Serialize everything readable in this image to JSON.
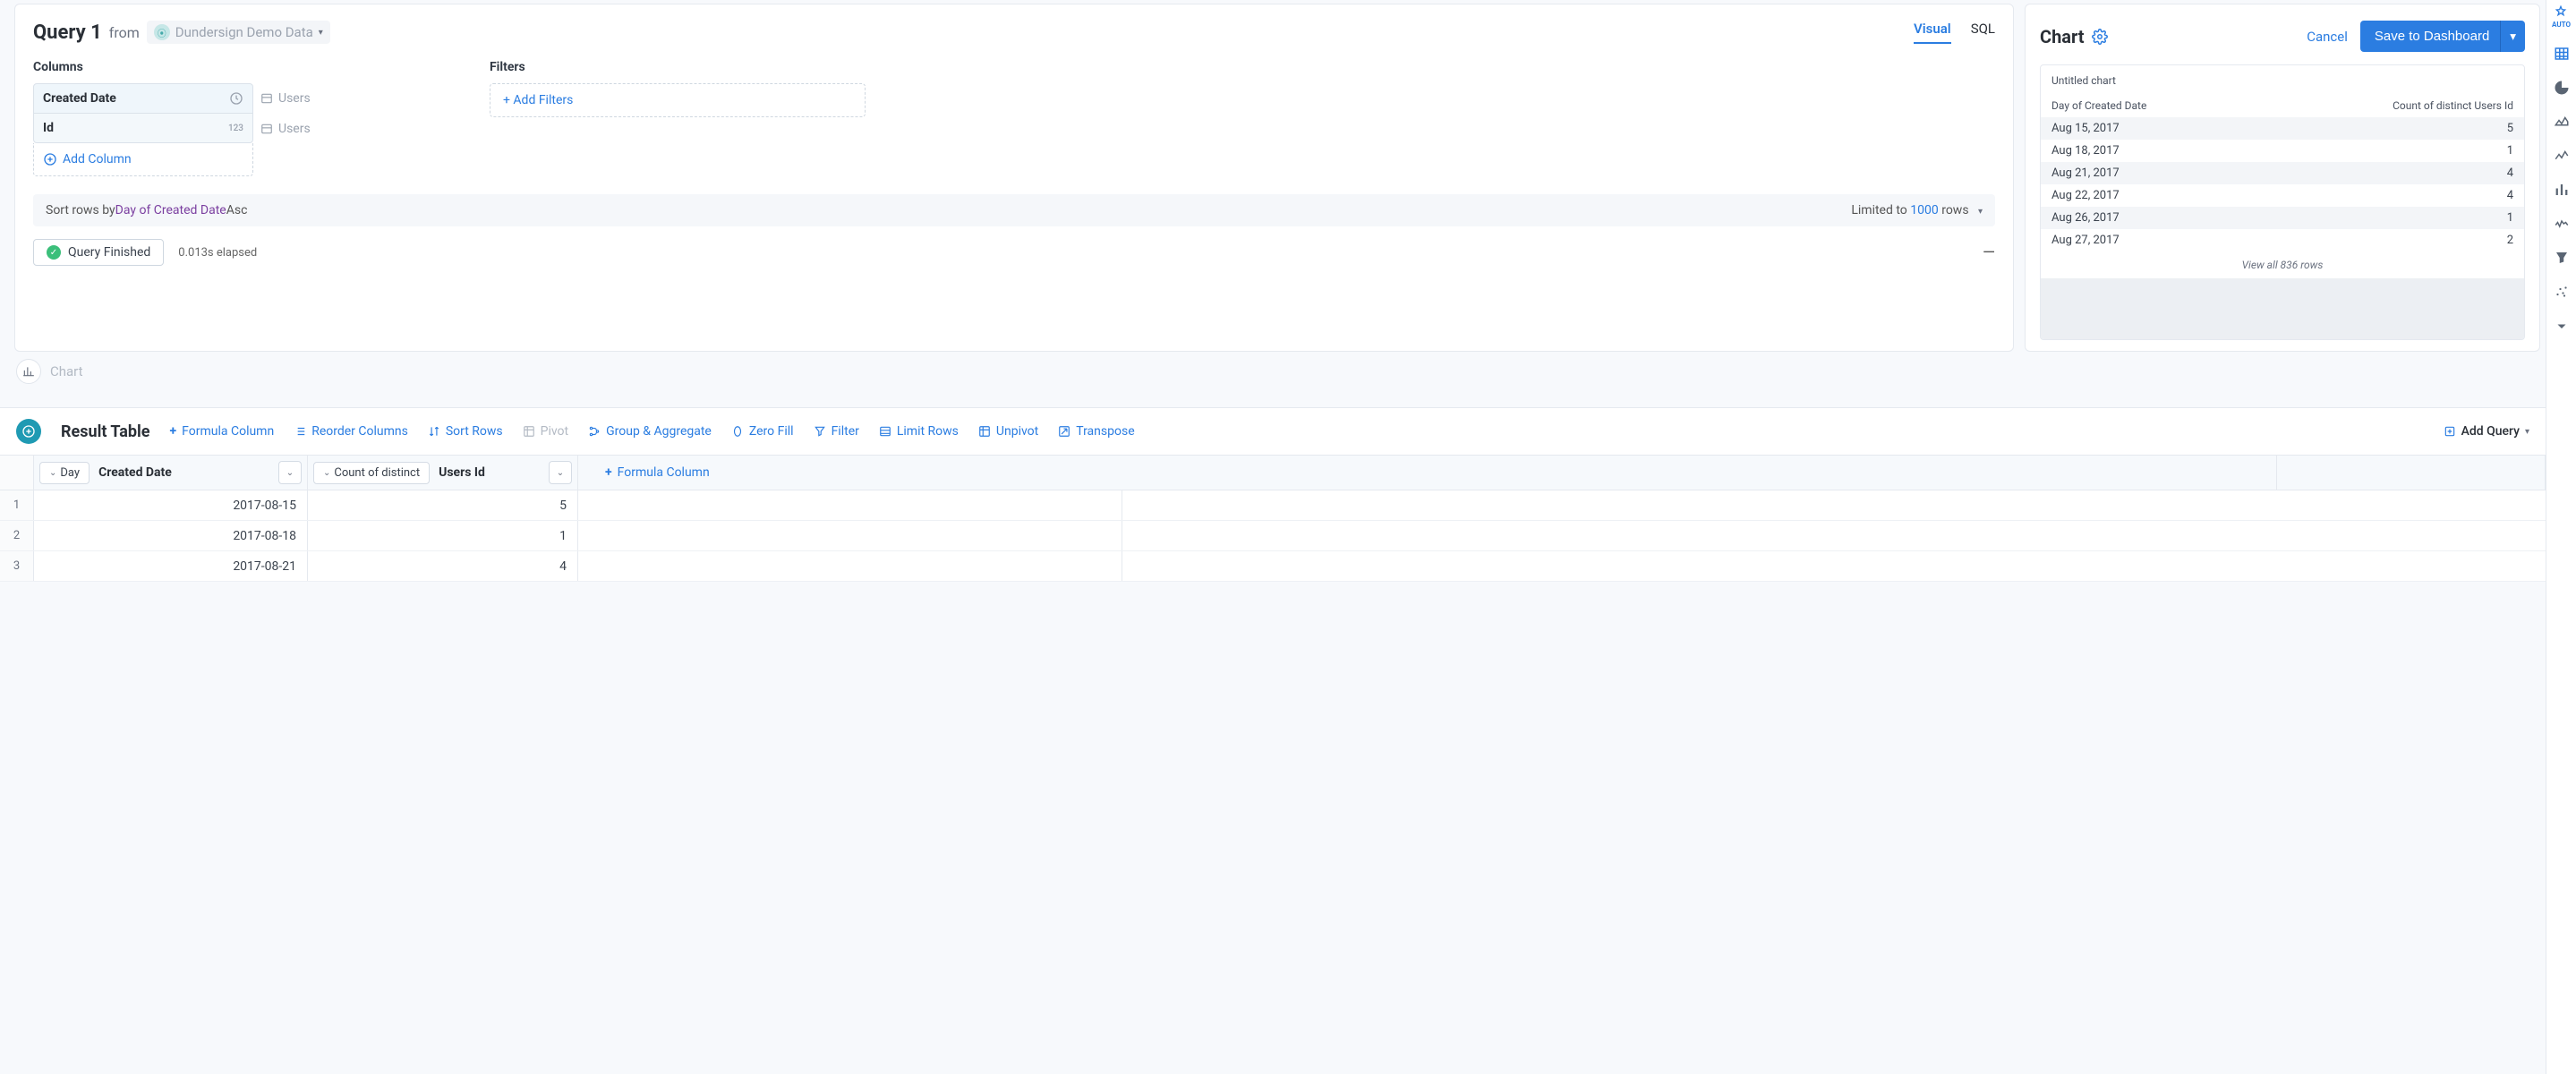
{
  "query": {
    "title": "Query 1",
    "from_label": "from",
    "source": "Dundersign Demo Data",
    "tabs": {
      "visual": "Visual",
      "sql": "SQL"
    },
    "columns_title": "Columns",
    "filters_title": "Filters",
    "columns": [
      {
        "name": "Created Date",
        "type_icon": "clock",
        "source": "Users"
      },
      {
        "name": "Id",
        "type_label": "123",
        "source": "Users"
      }
    ],
    "add_column": "Add Column",
    "add_filters": "+ Add Filters",
    "sort_prefix": "Sort rows by ",
    "sort_field": "Day of Created Date",
    "sort_dir": " Asc",
    "limit_prefix": "Limited to ",
    "limit_num": "1000",
    "limit_suffix": " rows",
    "status": "Query Finished",
    "elapsed": "0.013s elapsed",
    "chart_chip": "Chart"
  },
  "chart": {
    "title": "Chart",
    "cancel": "Cancel",
    "save": "Save to Dashboard",
    "untitled": "Untitled chart",
    "col1": "Day of Created Date",
    "col2": "Count of distinct Users Id",
    "rows": [
      {
        "d": "Aug 15, 2017",
        "v": "5"
      },
      {
        "d": "Aug 18, 2017",
        "v": "1"
      },
      {
        "d": "Aug 21, 2017",
        "v": "4"
      },
      {
        "d": "Aug 22, 2017",
        "v": "4"
      },
      {
        "d": "Aug 26, 2017",
        "v": "1"
      },
      {
        "d": "Aug 27, 2017",
        "v": "2"
      }
    ],
    "viewall": "View all 836 rows"
  },
  "results": {
    "title": "Result Table",
    "tools": {
      "formula": "Formula Column",
      "reorder": "Reorder Columns",
      "sort": "Sort Rows",
      "pivot": "Pivot",
      "group": "Group & Aggregate",
      "zerofill": "Zero Fill",
      "filter": "Filter",
      "limit": "Limit Rows",
      "unpivot": "Unpivot",
      "transpose": "Transpose"
    },
    "add_query": "Add Query",
    "header": {
      "col1_prefix": "Day",
      "col1_name": "Created Date",
      "col2_prefix": "Count of distinct",
      "col2_name": "Users Id",
      "formula": "Formula Column"
    },
    "rows": [
      {
        "n": "1",
        "d": "2017-08-15",
        "v": "5"
      },
      {
        "n": "2",
        "d": "2017-08-18",
        "v": "1"
      },
      {
        "n": "3",
        "d": "2017-08-21",
        "v": "4"
      }
    ]
  },
  "rail": {
    "auto": "AUTO"
  },
  "chart_data": {
    "type": "table",
    "title": "Untitled chart",
    "columns": [
      "Day of Created Date",
      "Count of distinct Users Id"
    ],
    "rows": [
      [
        "Aug 15, 2017",
        5
      ],
      [
        "Aug 18, 2017",
        1
      ],
      [
        "Aug 21, 2017",
        4
      ],
      [
        "Aug 22, 2017",
        4
      ],
      [
        "Aug 26, 2017",
        1
      ],
      [
        "Aug 27, 2017",
        2
      ]
    ],
    "total_rows": 836
  }
}
